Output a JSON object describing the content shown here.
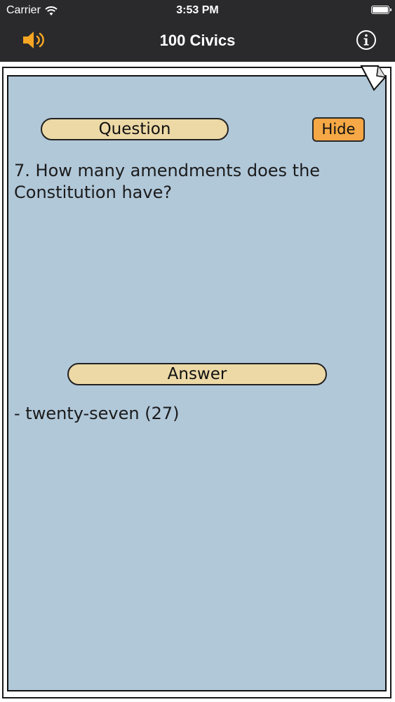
{
  "status_bar": {
    "carrier": "Carrier",
    "time": "3:53 PM",
    "icons": [
      "wifi-icon",
      "battery-icon"
    ]
  },
  "nav": {
    "title": "100 Civics",
    "left_icon": "speaker-icon",
    "right_icon": "info-icon"
  },
  "card": {
    "question_label": "Question",
    "hide_label": "Hide",
    "question": "7. How many amendments does the Constitution have?",
    "answer_label": "Answer",
    "answer": "- twenty-seven (27)"
  },
  "colors": {
    "topbar": "#2a2a2c",
    "card_bg": "#b1c8d9",
    "pill_bg": "#ecd9a6",
    "hide_bg": "#f5a845",
    "speaker": "#f5a623"
  }
}
